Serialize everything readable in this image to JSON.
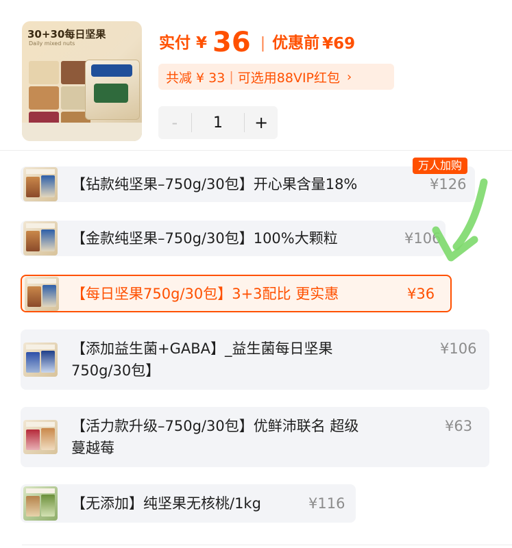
{
  "product": {
    "image_brand": "30+30每日坚果",
    "image_sub": "Daily mixed nuts"
  },
  "price": {
    "final_label": "实付 ¥",
    "final_value": "36",
    "separator": "|",
    "original_label": "优惠前",
    "original_value": "¥69"
  },
  "promo": {
    "saving": "共减 ¥ 33",
    "separator": "|",
    "vip": "可选用88VIP红包",
    "chevron": "›"
  },
  "quantity": {
    "minus": "-",
    "value": "1",
    "plus": "+"
  },
  "badge": {
    "hot": "万人加购"
  },
  "options": [
    {
      "name": "【钻款纯坚果–750g/30包】开心果含量18%",
      "price": "¥126",
      "selected": false
    },
    {
      "name": "【金款纯坚果–750g/30包】100%大颗粒",
      "price": "¥106",
      "selected": false
    },
    {
      "name": "【每日坚果750g/30包】3+3配比  更实惠",
      "price": "¥36",
      "selected": true
    },
    {
      "name_line1": "【添加益生菌+GABA】_益生菌每日坚果",
      "name_line2": "750g/30包】",
      "price": "¥106",
      "selected": false
    },
    {
      "name_line1": "【活力款升级–750g/30包】优鲜沛联名 超级",
      "name_line2": "蔓越莓",
      "price": "¥63",
      "selected": false
    },
    {
      "name": "【无添加】纯坚果无核桃/1kg",
      "price": "¥116",
      "selected": false
    }
  ],
  "colors": {
    "accent": "#ff5000",
    "row_bg": "#f3f4f7",
    "annotation_arrow": "#7dd96b"
  }
}
